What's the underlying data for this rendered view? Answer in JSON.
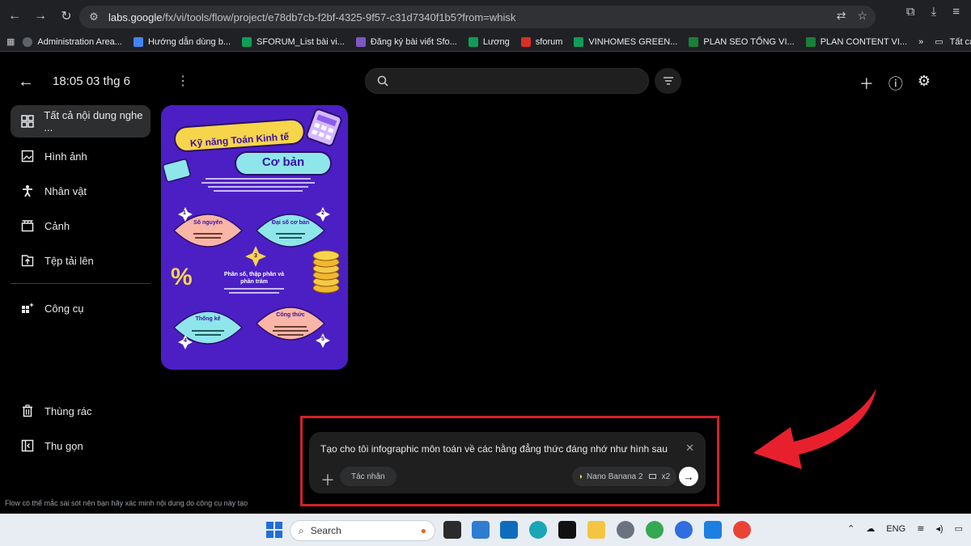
{
  "browser": {
    "url_host": "labs.google",
    "url_path": "/fx/vi/tools/flow/project/e78db7cb-f2bf-4325-9f57-c31d7340f1b5?from=whisk",
    "bookmarks": [
      {
        "label": "Administration Area...",
        "color": "#5f6368"
      },
      {
        "label": "Hướng dẫn dùng b...",
        "color": "#4285f4"
      },
      {
        "label": "SFORUM_List bài vi...",
        "color": "#0f9d58"
      },
      {
        "label": "Đăng ký bài viết Sfo...",
        "color": "#7e57c2"
      },
      {
        "label": "Lương",
        "color": "#0f9d58"
      },
      {
        "label": "sforum",
        "color": "#d93025"
      },
      {
        "label": "VINHOMES GREEN...",
        "color": "#0f9d58"
      },
      {
        "label": "PLAN SEO TỔNG VI...",
        "color": "#188038"
      },
      {
        "label": "PLAN CONTENT VI...",
        "color": "#188038"
      }
    ],
    "bookmarks_more": "»",
    "bookmarks_all": "Tất cả"
  },
  "header": {
    "title": "18:05 03 thg 6"
  },
  "sidebar": {
    "items": [
      {
        "label": "Tất cả nội dung nghe ...",
        "icon": "grid-icon"
      },
      {
        "label": "Hình ảnh",
        "icon": "image-icon"
      },
      {
        "label": "Nhân vật",
        "icon": "person-icon"
      },
      {
        "label": "Cảnh",
        "icon": "clapper-icon"
      },
      {
        "label": "Tệp tải lên",
        "icon": "upload-icon"
      }
    ],
    "tools_label": "Công cụ",
    "trash_label": "Thùng rác",
    "collapse_label": "Thu gọn"
  },
  "infographic": {
    "title_line1": "Kỹ năng Toán Kinh tế",
    "title_line2": "Cơ bản",
    "sections": [
      {
        "num": "1",
        "label": "Số nguyên"
      },
      {
        "num": "2",
        "label": "Đại số cơ bản"
      },
      {
        "num": "3",
        "label": "Phân số, thập phân và phần trăm"
      },
      {
        "num": "4",
        "label": "Thống kê"
      },
      {
        "num": "5",
        "label": "Công thức"
      }
    ],
    "percent": "%"
  },
  "prompt": {
    "text": "Tạo cho tôi infographic môn toán về các hằng đẳng thức đáng nhớ như hình sau",
    "chip_label": "Tác nhân",
    "model_label": "Nano Banana 2",
    "count_label": "x2"
  },
  "footer_note": "Flow có thể mắc sai sót nên bạn hãy xác minh nội dung do công cụ này tạo",
  "taskbar": {
    "search_label": "Search",
    "lang": "ENG"
  },
  "colors": {
    "highlight_red": "#d4202a",
    "card_purple": "#4b1fc4",
    "banner_yellow": "#f7d54a",
    "banner_cyan": "#8ee6ea"
  }
}
